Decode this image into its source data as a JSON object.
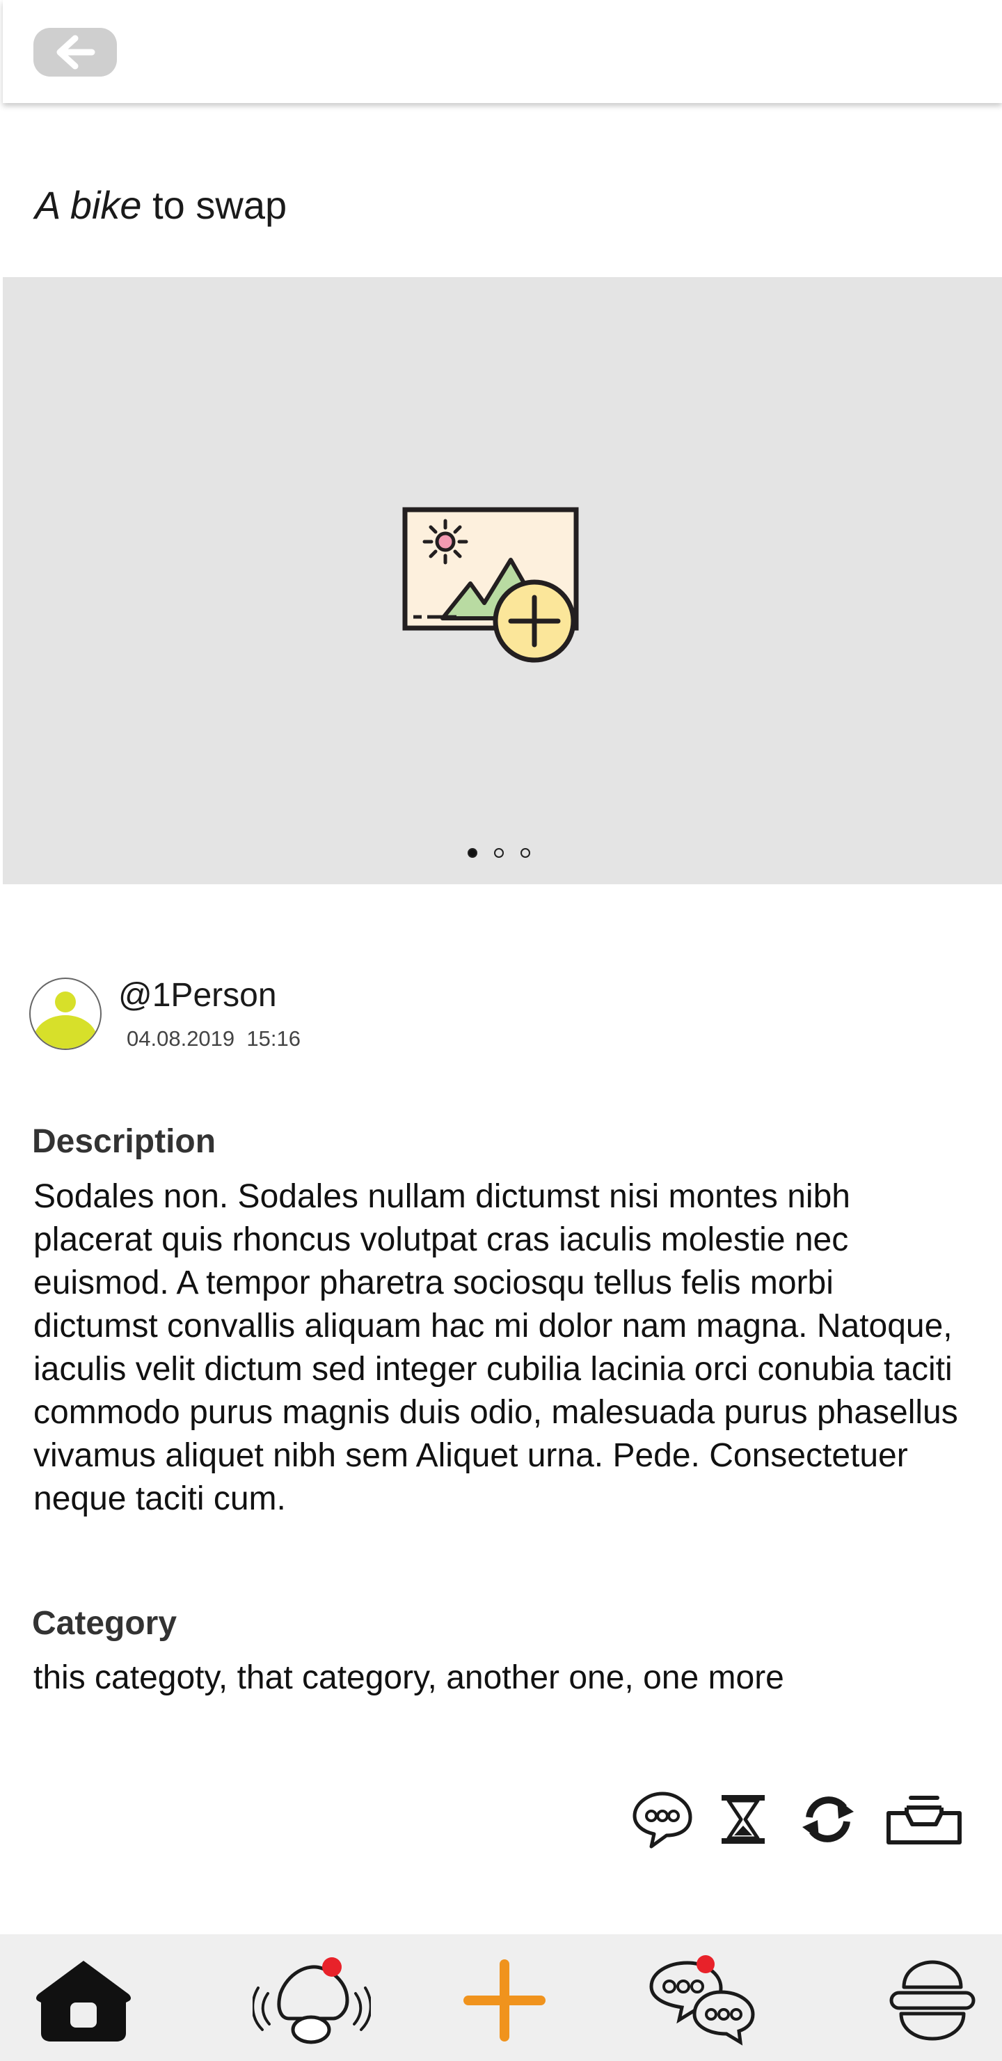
{
  "header": {
    "back_icon": "arrow-left-icon"
  },
  "listing": {
    "title_italic": "A bike",
    "title_rest": " to swap"
  },
  "gallery": {
    "add_image_icon": "add-image-icon",
    "page_count": 3,
    "active_page": 1
  },
  "author": {
    "avatar_icon": "user-avatar-icon",
    "username": "@1Person",
    "date": "04.08.2019",
    "time": "15:16"
  },
  "description": {
    "heading": "Description",
    "text": "Sodales non. Sodales nullam dictumst nisi montes nibh placerat quis rhoncus volutpat cras iaculis molestie nec euismod. A tempor pharetra sociosqu tellus felis morbi dictumst convallis aliquam hac mi dolor nam magna. Natoque, iaculis velit dictum sed integer cubilia lacinia orci conubia taciti commodo purus magnis duis odio, malesuada purus phasellus vivamus aliquet nibh sem Aliquet urna. Pede. Consectetuer neque taciti cum."
  },
  "category": {
    "heading": "Category",
    "text": "this categoty, that category, another one, one more"
  },
  "actions": [
    {
      "icon": "chat-bubble-icon"
    },
    {
      "icon": "hourglass-icon"
    },
    {
      "icon": "refresh-icon"
    },
    {
      "icon": "inbox-tray-icon"
    }
  ],
  "bottom_nav": [
    {
      "icon": "home-icon",
      "badge": false
    },
    {
      "icon": "nearby-person-icon",
      "badge": true
    },
    {
      "icon": "add-plus-icon",
      "badge": false
    },
    {
      "icon": "messages-icon",
      "badge": true
    },
    {
      "icon": "menu-icon",
      "badge": false
    }
  ],
  "colors": {
    "plus_orange": "#f0931d",
    "badge_red": "#e8222a",
    "avatar_yellow": "#d7e02a",
    "gallery_bg": "#e4e4e4",
    "nav_bg": "#efefef"
  }
}
